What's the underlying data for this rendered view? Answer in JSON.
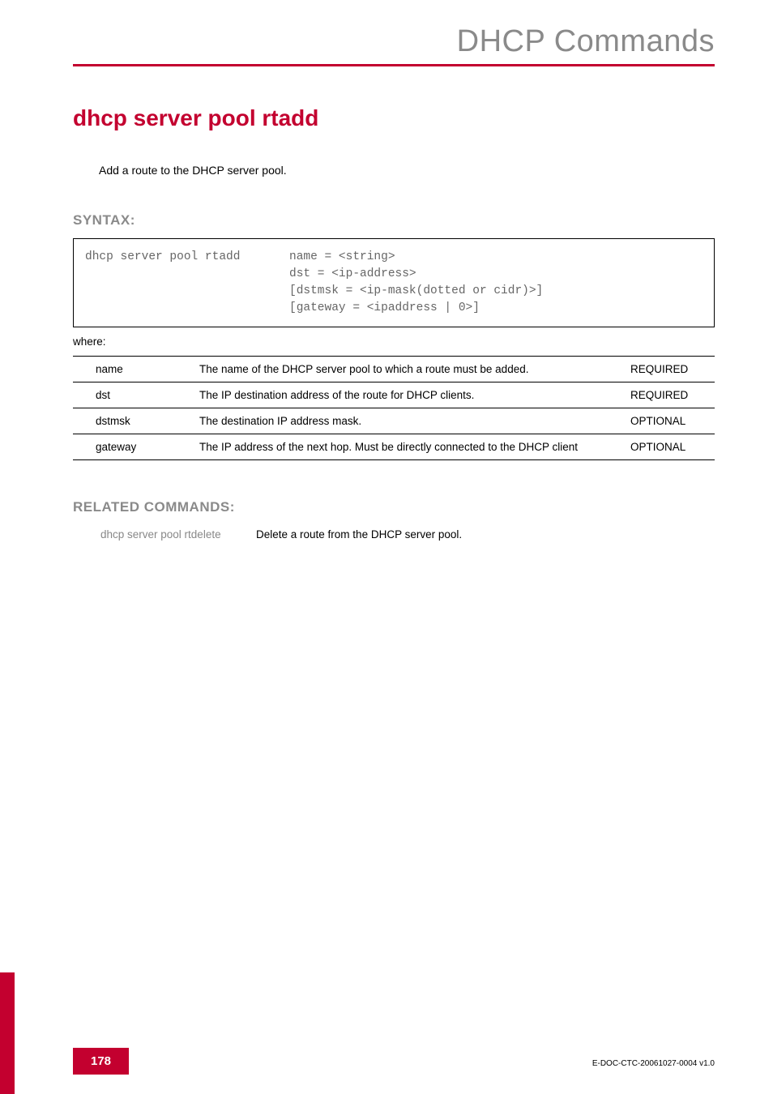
{
  "header": {
    "title": "DHCP Commands"
  },
  "command": {
    "title": "dhcp server pool rtadd",
    "description": "Add a route to the DHCP server pool."
  },
  "syntax": {
    "heading": "SYNTAX:",
    "command_text": "dhcp server pool rtadd",
    "args_text": "name = <string>\ndst = <ip-address>\n[dstmsk = <ip-mask(dotted or cidr)>]\n[gateway = <ipaddress | 0>]",
    "where_label": "where:",
    "params": [
      {
        "name": "name",
        "desc": "The name of the DHCP server pool to which a route must be added.",
        "req": "REQUIRED"
      },
      {
        "name": "dst",
        "desc": "The IP destination address of the route for DHCP clients.",
        "req": "REQUIRED"
      },
      {
        "name": "dstmsk",
        "desc": "The destination IP address mask.",
        "req": "OPTIONAL"
      },
      {
        "name": "gateway",
        "desc": "The IP address of the next hop. Must be directly connected to the DHCP client",
        "req": "OPTIONAL"
      }
    ]
  },
  "related": {
    "heading": "RELATED COMMANDS:",
    "items": [
      {
        "name": "dhcp server pool rtdelete",
        "desc": "Delete a route from the DHCP server pool."
      }
    ]
  },
  "footer": {
    "page": "178",
    "doc_id": "E-DOC-CTC-20061027-0004 v1.0"
  }
}
